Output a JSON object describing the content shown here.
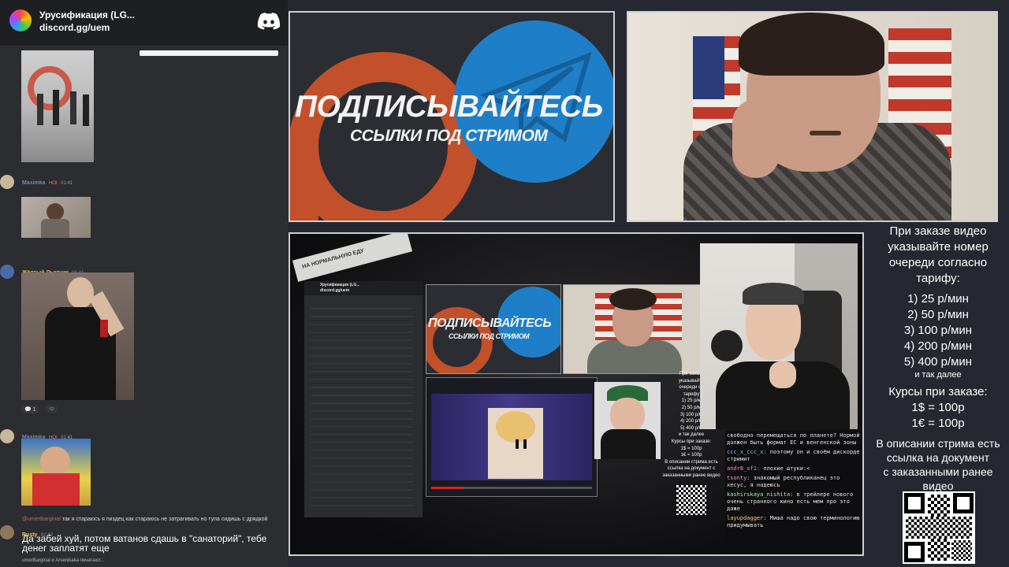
{
  "discord": {
    "server_name": "Урусификация (LG...",
    "server_link": "discord.gg/uem",
    "messages": [
      {
        "user": "Maximka",
        "badge": "HOI",
        "time": "01:41"
      },
      {
        "user": "Жёлтый Льотчик",
        "time": "01:41",
        "reaction_count": "1"
      },
      {
        "user": "Maximka",
        "badge": "HOI",
        "time": "01:41"
      }
    ],
    "reply_preview_user": "@umerBarginal",
    "reply_preview_text": "так я стараюсь я пиздец как стараюсь не затрагивать но тупа сидишь с дрядкой",
    "last_user": "Rusty",
    "last_time": "01:42",
    "last_message": "Да забей хуй, потом ватанов сдашь в \"санаторий\", тебе денег заплатят еще",
    "typing": "umerBarginal и Arsenikaka печатают..."
  },
  "promo": {
    "title": "ПОДПИСЫВАЙТЕСЬ",
    "subtitle": "ССЫЛКИ ПОД СТРИМОМ"
  },
  "nested": {
    "tape_text": "НА НОРМАЛЬНУЮ ЕДУ",
    "promo_title": "ПОДПИСЫВАЙТЕСЬ",
    "promo_subtitle": "ССЫЛКИ ПОД СТРИМОМ",
    "server_name": "Урусификация (LG...",
    "server_link": "discord.gg/uem",
    "chat": [
      {
        "user": "",
        "text": "свободно перемещаться по планете? Нормой должен быть формат ЕС и венгенской зоны"
      },
      {
        "user": "ccc_x_ccc_x:",
        "text": "поэтому он и своём дискорде стримит"
      },
      {
        "user": "andr8_sf1:",
        "text": "плохие штуки:<"
      },
      {
        "user": "tsonty:",
        "text": "знакомый республиканец это хесус, я надеюсь"
      },
      {
        "user": "kashirskaya_nishita:",
        "text": "в трейлере нового очень странного кино есть мем про это даже"
      },
      {
        "user": "layupdagger:",
        "text": "Миша надо свою терминологию придумывать"
      }
    ],
    "mini_info": [
      "При заказе",
      "указывайте",
      "очереди со",
      "тарифу",
      "1) 25 р/м",
      "2) 50 р/м",
      "3) 100 р/м",
      "4) 200 р/м",
      "5) 400 р/м",
      "и так далее",
      "Курсы при заказе:",
      "1$ = 100р",
      "1€ = 100р",
      "В описании стрима есть ссылка на документ с заказанными ранее видео"
    ]
  },
  "info": {
    "line1": "При заказе видео",
    "line2": "указывайте номер",
    "line3": "очереди согласно",
    "line4": "тарифу:",
    "tariffs": [
      "1) 25 р/мин",
      "2) 50 р/мин",
      "3) 100 р/мин",
      "4) 200 р/мин",
      "5) 400 р/мин"
    ],
    "etc": "и так далее",
    "rates_title": "Курсы при заказе:",
    "rate1": "1$ = 100р",
    "rate2": "1€ = 100р",
    "desc1": "В описании стрима есть",
    "desc2": "ссылка на документ",
    "desc3": "с заказанными ранее",
    "desc4": "видео"
  },
  "colors": {
    "telegram_blue": "#1e7fc8",
    "rutube_orange": "#d0522a",
    "discord_bg": "#2b2d31",
    "accent_red": "#e84a4a"
  }
}
